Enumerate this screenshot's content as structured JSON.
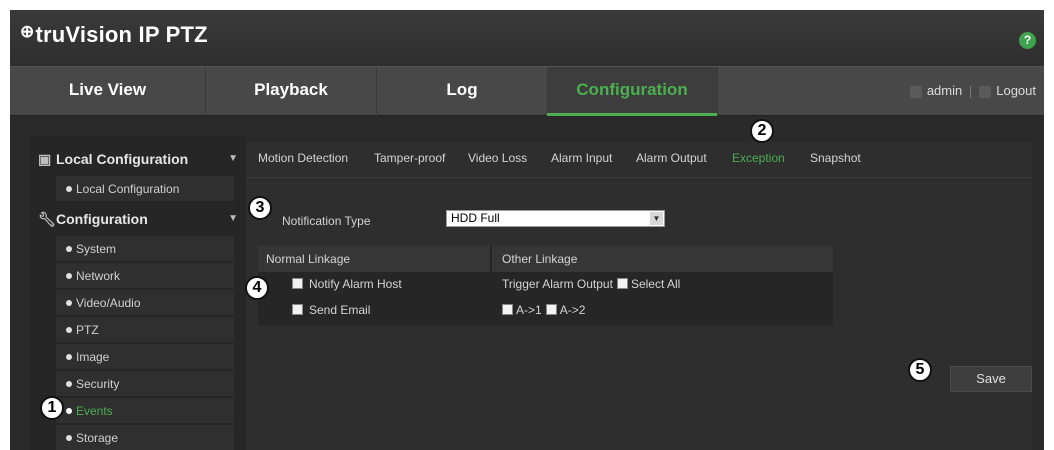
{
  "header": {
    "logo_mark": "⊕",
    "title": "truVision IP PTZ",
    "help_icon_label": "?"
  },
  "topnav": {
    "tabs": [
      "Live View",
      "Playback",
      "Log",
      "Configuration"
    ],
    "active_tab": "Configuration",
    "user": "admin",
    "logout": "Logout"
  },
  "sidebar": {
    "groups": [
      {
        "label": "Local Configuration",
        "icon": "local-config-icon",
        "items": [
          "Local Configuration"
        ]
      },
      {
        "label": "Configuration",
        "icon": "wrench-icon",
        "items": [
          "System",
          "Network",
          "Video/Audio",
          "PTZ",
          "Image",
          "Security",
          "Events",
          "Storage"
        ]
      }
    ],
    "active_item": "Events"
  },
  "subtabs": {
    "items": [
      "Motion Detection",
      "Tamper-proof",
      "Video Loss",
      "Alarm Input",
      "Alarm Output",
      "Exception",
      "Snapshot"
    ],
    "active": "Exception"
  },
  "form": {
    "notification_label": "Notification Type",
    "notification_value": "HDD Full",
    "normal_linkage_header": "Normal Linkage",
    "other_linkage_header": "Other Linkage",
    "notify_alarm_host": "Notify Alarm Host",
    "send_email": "Send Email",
    "trigger_alarm_output": "Trigger Alarm Output",
    "select_all": "Select All",
    "output_a1": "A->1",
    "output_a2": "A->2",
    "save_label": "Save"
  },
  "callouts": [
    "1",
    "2",
    "3",
    "4",
    "5"
  ],
  "colors": {
    "accent": "#4caf50",
    "header_bg": "#333333",
    "content_bg": "#2e2e2e"
  }
}
